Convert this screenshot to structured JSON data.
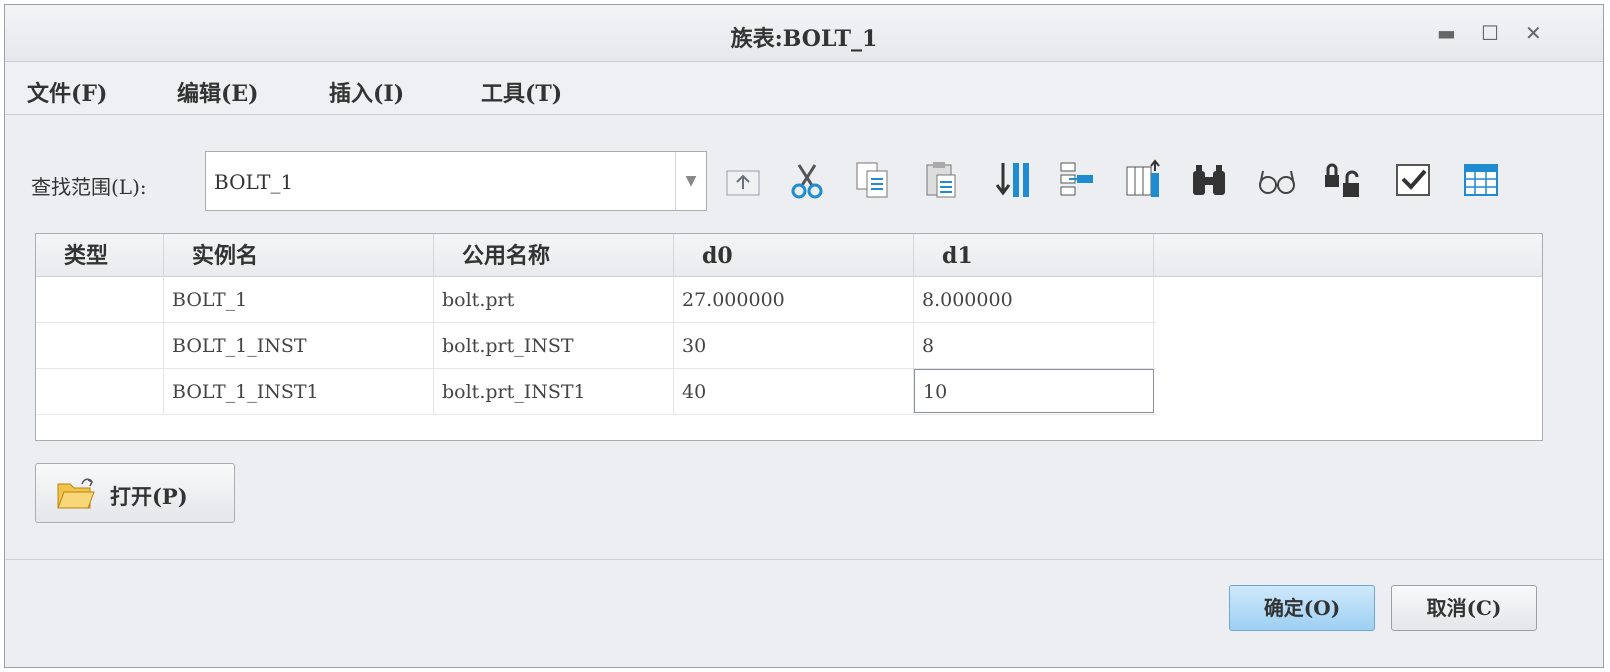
{
  "window": {
    "title": "族表:BOLT_1"
  },
  "menu": [
    {
      "label": "文件(F)"
    },
    {
      "label": "编辑(E)"
    },
    {
      "label": "插入(I)"
    },
    {
      "label": "工具(T)"
    }
  ],
  "lookin": {
    "label": "查找范围(L):",
    "value": "BOLT_1"
  },
  "toolbar": [
    "folder-up-icon",
    "cut-icon",
    "copy-icon",
    "paste-icon",
    "insert-column-icon",
    "insert-row-icon",
    "add-column-icon",
    "find-icon",
    "glasses-icon",
    "lock-icon",
    "verify-checkbox-icon",
    "table-icon"
  ],
  "table": {
    "headers": [
      "类型",
      "实例名",
      "公用名称",
      "d0",
      "d1"
    ],
    "rows": [
      {
        "type": "",
        "instance": "BOLT_1",
        "common": "bolt.prt",
        "d0": "27.000000",
        "d1": "8.000000"
      },
      {
        "type": "",
        "instance": "BOLT_1_INST",
        "common": "bolt.prt_INST",
        "d0": "30",
        "d1": "8"
      },
      {
        "type": "",
        "instance": "BOLT_1_INST1",
        "common": "bolt.prt_INST1",
        "d0": "40",
        "d1": "10"
      }
    ]
  },
  "open_button": {
    "label": "打开(P)"
  },
  "buttons": {
    "ok": "确定(O)",
    "cancel": "取消(C)"
  },
  "colors": {
    "accent": "#9dd0f3",
    "icon_blue": "#1f8bd1"
  }
}
